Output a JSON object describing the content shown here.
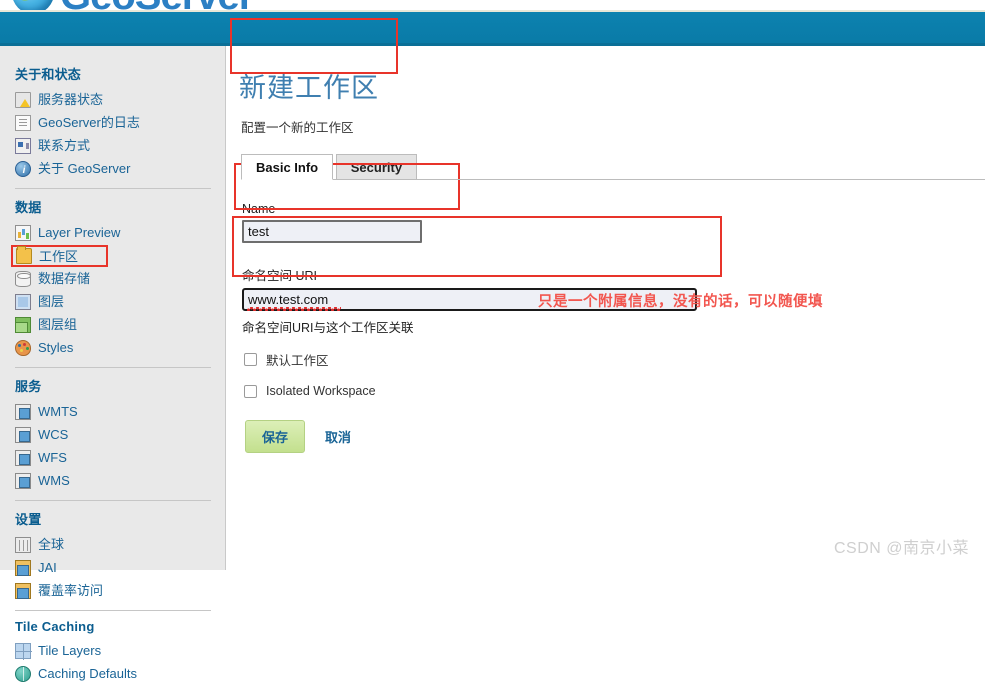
{
  "brand": {
    "name": "GeoServer",
    "logo_icon": "geoserver-globe-icon"
  },
  "sidebar": {
    "groups": [
      {
        "title": "关于和状态",
        "items": [
          {
            "label": "服务器状态",
            "icon": "server-status-icon"
          },
          {
            "label": "GeoServer的日志",
            "icon": "document-icon"
          },
          {
            "label": "联系方式",
            "icon": "contact-card-icon"
          },
          {
            "label": "关于 GeoServer",
            "icon": "info-icon"
          }
        ]
      },
      {
        "title": "数据",
        "items": [
          {
            "label": "Layer Preview",
            "icon": "layer-preview-icon"
          },
          {
            "label": "工作区",
            "icon": "folder-icon",
            "highlighted": true
          },
          {
            "label": "数据存储",
            "icon": "datastore-icon"
          },
          {
            "label": "图层",
            "icon": "layer-icon"
          },
          {
            "label": "图层组",
            "icon": "layer-group-icon"
          },
          {
            "label": "Styles",
            "icon": "styles-palette-icon"
          }
        ]
      },
      {
        "title": "服务",
        "items": [
          {
            "label": "WMTS",
            "icon": "service-icon"
          },
          {
            "label": "WCS",
            "icon": "service-icon"
          },
          {
            "label": "WFS",
            "icon": "service-icon"
          },
          {
            "label": "WMS",
            "icon": "service-icon"
          }
        ]
      },
      {
        "title": "设置",
        "items": [
          {
            "label": "全球",
            "icon": "global-settings-icon"
          },
          {
            "label": "JAI",
            "icon": "jai-icon"
          },
          {
            "label": "覆盖率访问",
            "icon": "coverage-access-icon"
          }
        ]
      },
      {
        "title": "Tile Caching",
        "items": [
          {
            "label": "Tile Layers",
            "icon": "tile-layers-icon"
          },
          {
            "label": "Caching Defaults",
            "icon": "caching-defaults-icon"
          }
        ]
      }
    ]
  },
  "page": {
    "title": "新建工作区",
    "subtitle": "配置一个新的工作区"
  },
  "tabs": [
    {
      "label": "Basic Info",
      "active": true
    },
    {
      "label": "Security",
      "active": false
    }
  ],
  "form": {
    "name": {
      "label": "Name",
      "value": "test",
      "placeholder": ""
    },
    "uri": {
      "label": "命名空间 URI",
      "value": "www.test.com",
      "placeholder": "",
      "help": "命名空间URI与这个工作区关联"
    },
    "checkboxes": [
      {
        "label": "默认工作区",
        "checked": false
      },
      {
        "label": "Isolated Workspace",
        "checked": false
      }
    ],
    "buttons": {
      "save": "保存",
      "cancel": "取消"
    }
  },
  "annotations": {
    "note": "只是一个附属信息，没有的话，可以随便填",
    "color": "#e8342a"
  },
  "watermark": "CSDN @南京小菜",
  "colors": {
    "header_band": "#0b7fad",
    "sidebar_bg": "#e9e9e9",
    "link": "#1a6496",
    "title": "#3f7fb0",
    "annotation": "#e8342a",
    "save_button": "#cde6a0"
  }
}
